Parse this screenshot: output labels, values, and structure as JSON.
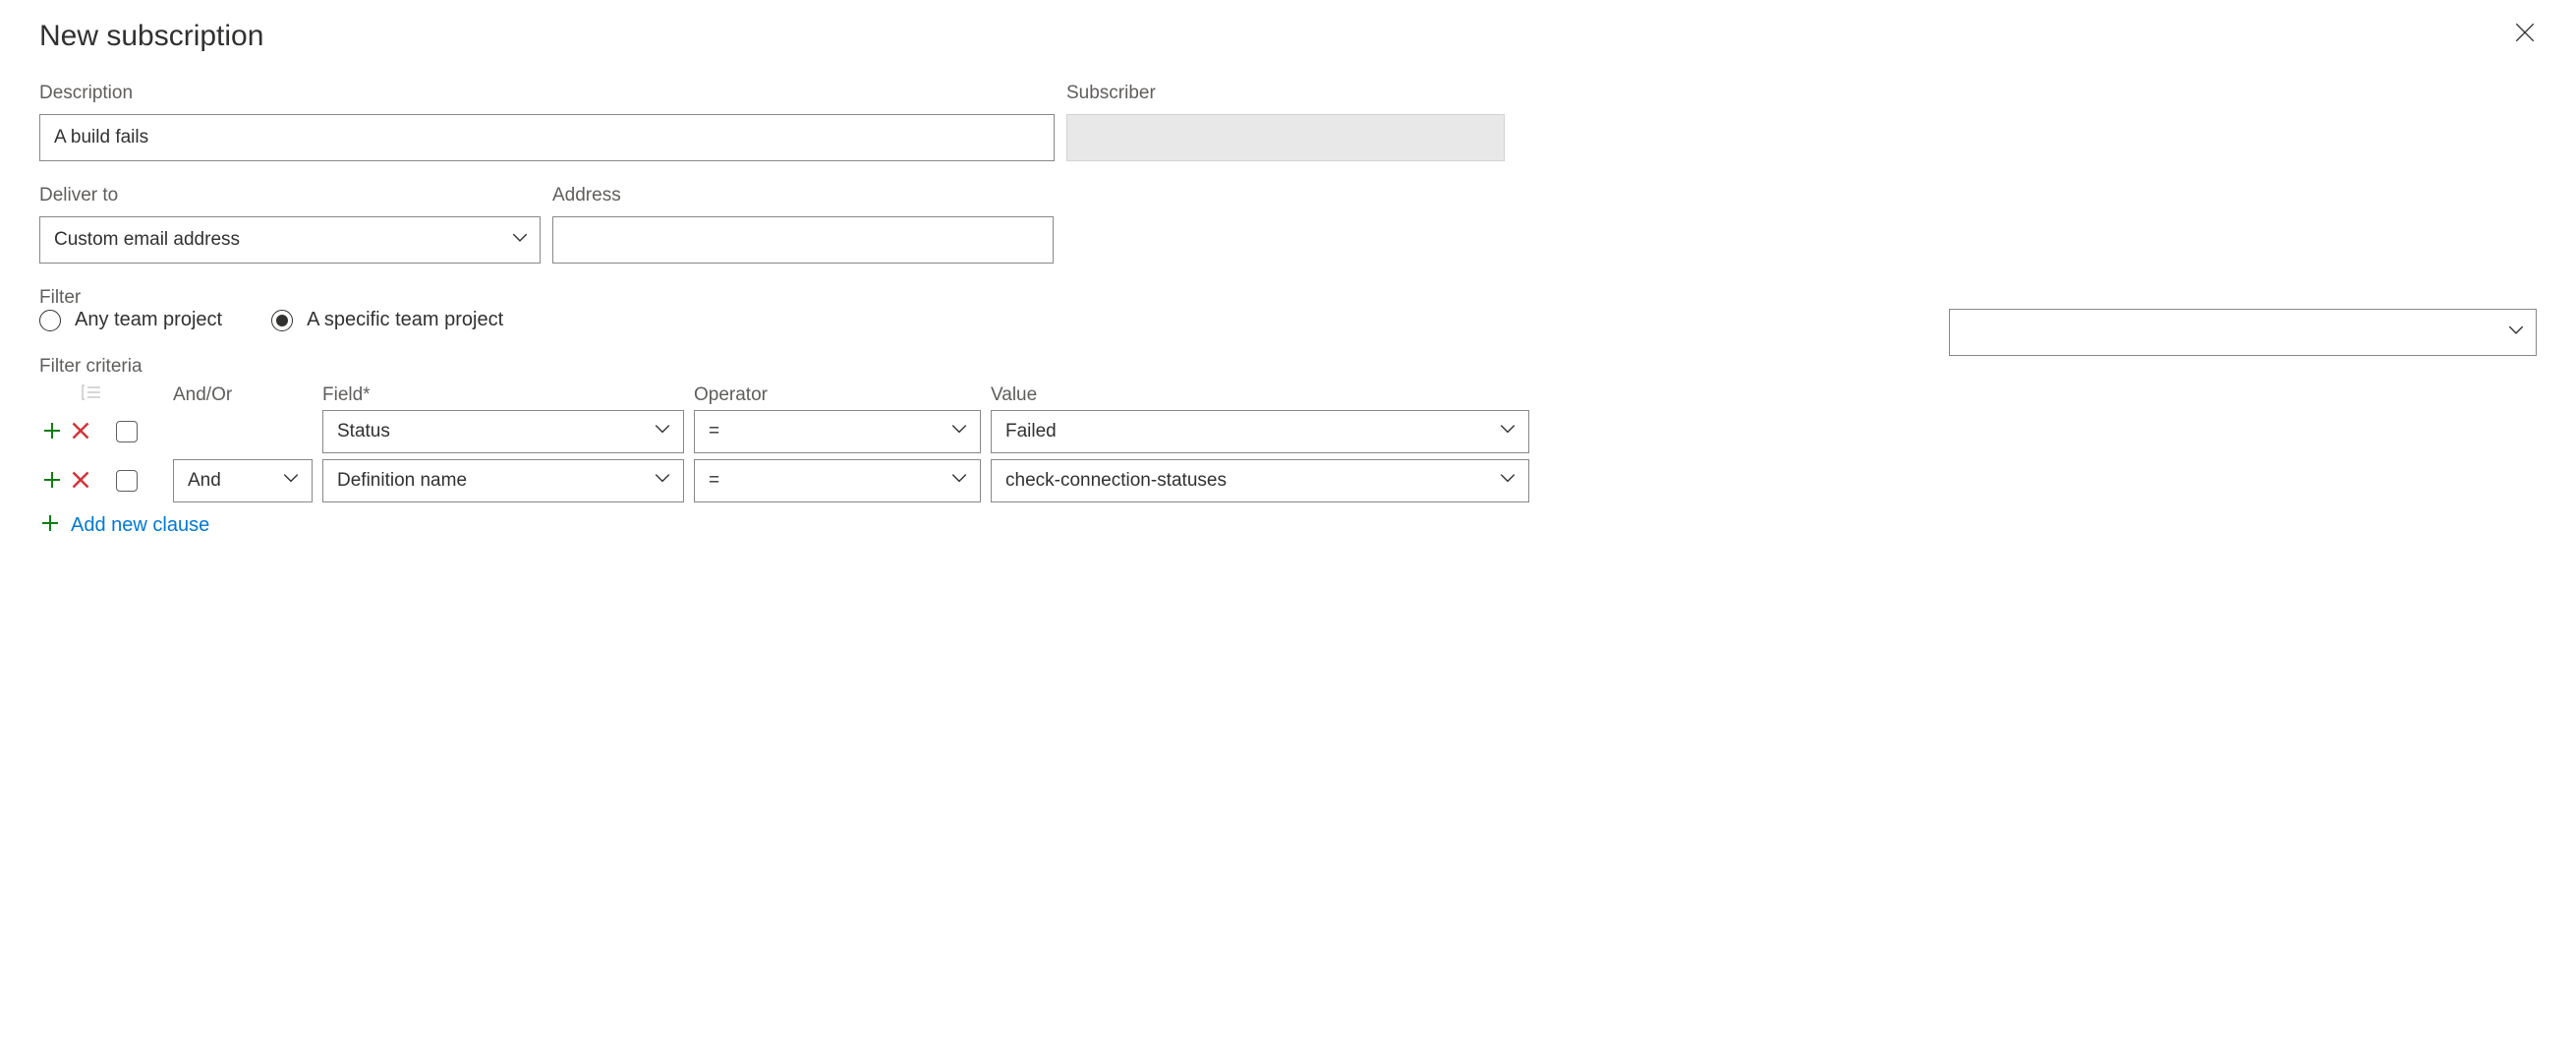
{
  "title": "New subscription",
  "description": {
    "label": "Description",
    "value": "A build fails"
  },
  "subscriber": {
    "label": "Subscriber",
    "value": ""
  },
  "deliver_to": {
    "label": "Deliver to",
    "value": "Custom email address"
  },
  "address": {
    "label": "Address",
    "value": ""
  },
  "filter": {
    "label": "Filter",
    "options": {
      "any": "Any team project",
      "specific": "A specific team project"
    },
    "selected": "specific",
    "project_value": ""
  },
  "criteria": {
    "label": "Filter criteria",
    "headers": {
      "andor": "And/Or",
      "field": "Field*",
      "operator": "Operator",
      "value": "Value"
    },
    "rows": [
      {
        "andor": "",
        "field": "Status",
        "operator": "=",
        "value": "Failed"
      },
      {
        "andor": "And",
        "field": "Definition name",
        "operator": "=",
        "value": "check-connection-statuses"
      }
    ],
    "add_link": "Add new clause"
  }
}
